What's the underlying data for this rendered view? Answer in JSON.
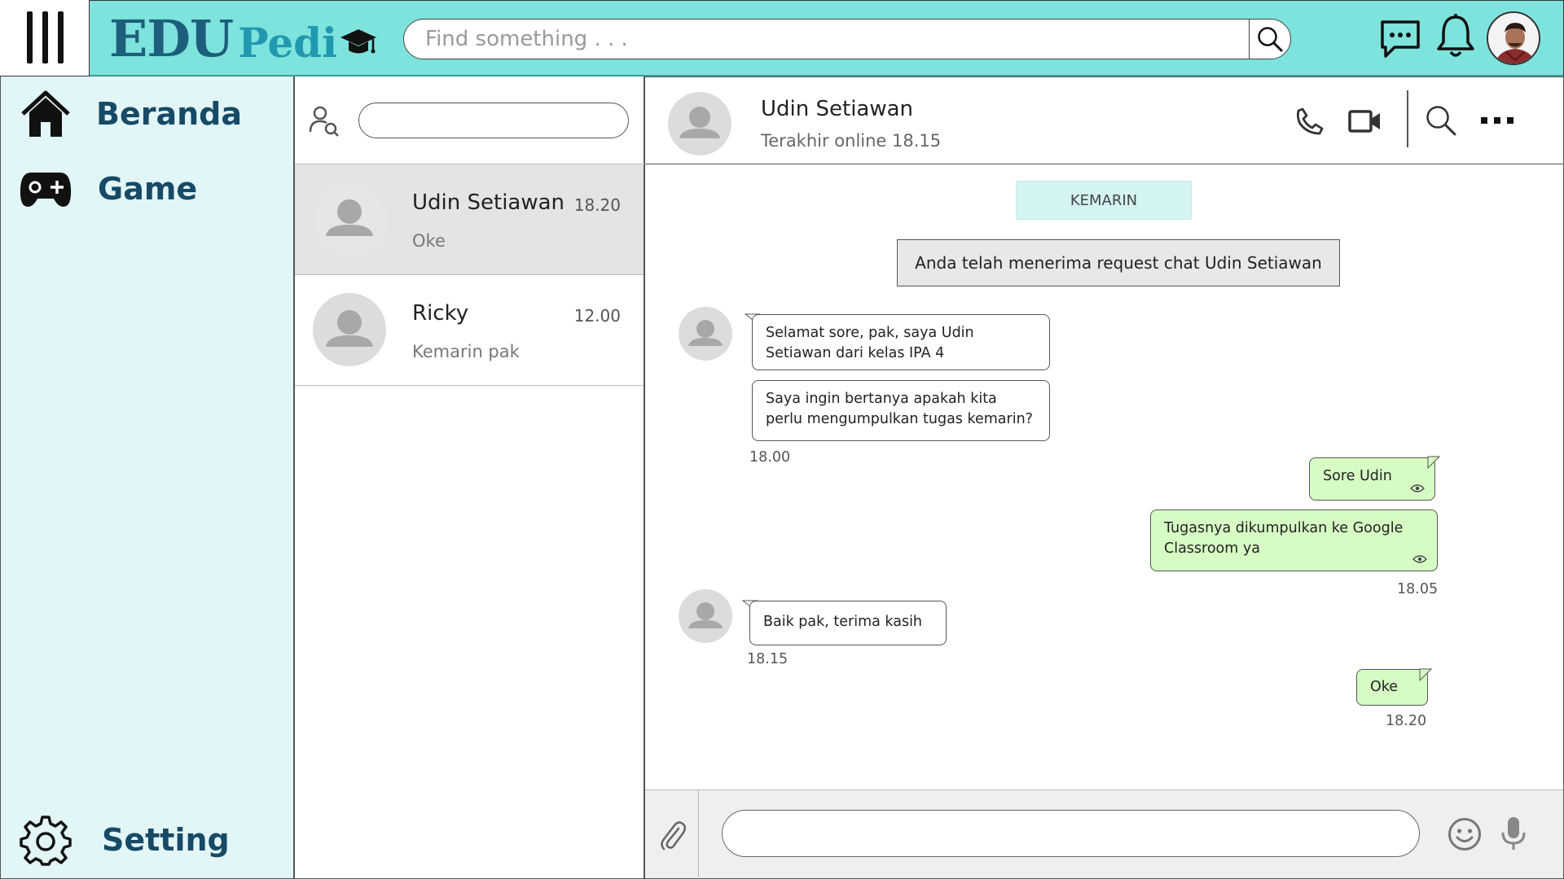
{
  "app": {
    "logo_main": "EDU",
    "logo_accent": "Pedi"
  },
  "topbar": {
    "search_placeholder": "Find something . . ."
  },
  "sidebar": {
    "items": [
      {
        "label": "Beranda",
        "icon": "home-icon"
      },
      {
        "label": "Game",
        "icon": "gamepad-icon"
      }
    ],
    "setting_label": "Setting"
  },
  "chat_list": {
    "search_value": "",
    "contacts": [
      {
        "name": "Udin Setiawan",
        "time": "18.20",
        "last_message": "Oke",
        "active": true
      },
      {
        "name": "Ricky",
        "time": "12.00",
        "last_message": "Kemarin pak",
        "active": false
      }
    ]
  },
  "conversation": {
    "contact_name": "Udin Setiawan",
    "status": "Terakhir online 18.15",
    "date_divider": "KEMARIN",
    "system_message": "Anda telah menerima request chat Udin Setiawan",
    "messages": [
      {
        "dir": "in",
        "text": "Selamat sore, pak, saya Udin Setiawan dari kelas IPA 4"
      },
      {
        "dir": "in",
        "text": "Saya ingin bertanya apakah kita perlu mengumpulkan tugas kemarin?",
        "time": "18.00"
      },
      {
        "dir": "out",
        "text": "Sore Udin"
      },
      {
        "dir": "out",
        "text": "Tugasnya dikumpulkan ke Google Classroom ya",
        "time": "18.05"
      },
      {
        "dir": "in",
        "text": "Baik pak, terima kasih",
        "time": "18.15"
      },
      {
        "dir": "out",
        "text": "Oke",
        "time": "18.20"
      }
    ],
    "composer_value": ""
  },
  "colors": {
    "topbar_bg": "#7de3dc",
    "sidebar_bg": "#e2f5f7",
    "outgoing_bubble": "#d6fcc4",
    "date_pill": "#d4f4f2",
    "brand_dark": "#1d5e7c",
    "brand_light": "#2098b0"
  }
}
